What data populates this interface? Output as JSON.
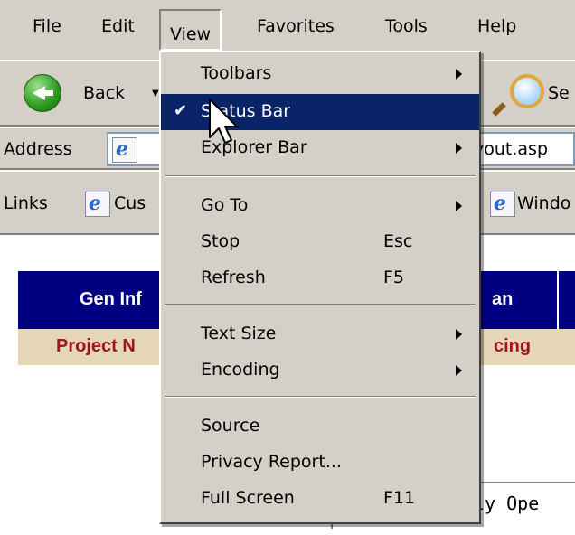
{
  "menubar": {
    "items": [
      "File",
      "Edit",
      "View",
      "Favorites",
      "Tools",
      "Help"
    ]
  },
  "toolbar": {
    "back_label": "Back",
    "search_partial": "Se"
  },
  "address_bar": {
    "label": "Address",
    "url_partial": "yout.asp"
  },
  "links_bar": {
    "label": "Links",
    "link1_partial": "Cus",
    "link2_partial": "Windo"
  },
  "page": {
    "header_cell1": "Gen Inf",
    "header_cell2": "an",
    "subheader_cell1": "Project N",
    "subheader_cell2": "cing",
    "mono_text": "ly Ope"
  },
  "view_menu": {
    "toolbars": "Toolbars",
    "status_bar": "Status Bar",
    "explorer_bar": "Explorer Bar",
    "go_to": "Go To",
    "stop": "Stop",
    "stop_key": "Esc",
    "refresh": "Refresh",
    "refresh_key": "F5",
    "text_size": "Text Size",
    "encoding": "Encoding",
    "source": "Source",
    "privacy_report": "Privacy Report...",
    "full_screen": "Full Screen",
    "full_screen_key": "F11"
  },
  "colors": {
    "menu_highlight": "#0a246a",
    "header_band": "#000080",
    "subheader_band": "#e5d7b5",
    "subheader_text": "#a0141e",
    "chrome": "#d4d0c8"
  }
}
